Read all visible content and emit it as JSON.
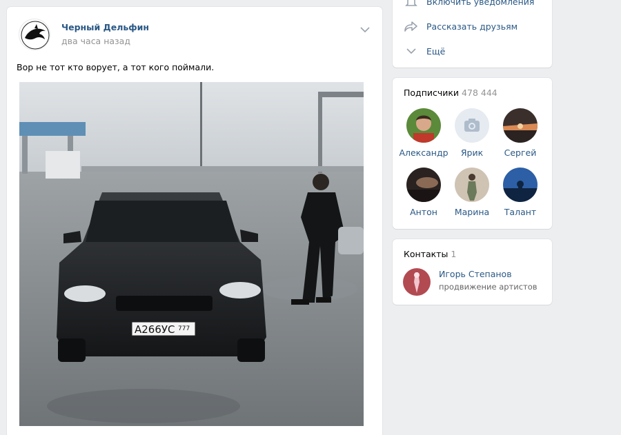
{
  "post": {
    "author": "Черный Дельфин",
    "time": "два часа назад",
    "text": "Вор не тот кто ворует, а тот кого поймали.",
    "menu_icon": "chevron-down-icon",
    "photo": {
      "subject": "car-photo",
      "plate_text": "А266УС",
      "plate_region": "777"
    }
  },
  "actions": {
    "items": [
      {
        "label": "Включить уведомления",
        "icon": "bell-icon"
      },
      {
        "label": "Рассказать друзьям",
        "icon": "share-icon"
      },
      {
        "label": "Ещё",
        "icon": "chevron-down-icon"
      }
    ]
  },
  "subscribers": {
    "title": "Подписчики",
    "count": "478 444",
    "people": [
      {
        "name": "Александр"
      },
      {
        "name": "Ярик"
      },
      {
        "name": "Сергей"
      },
      {
        "name": "Антон"
      },
      {
        "name": "Марина"
      },
      {
        "name": "Талант"
      }
    ]
  },
  "contacts": {
    "title": "Контакты",
    "count": "1",
    "person": {
      "name": "Игорь Степанов",
      "role": "продвижение артистов"
    }
  },
  "colors": {
    "link": "#2a5885",
    "muted": "#939393",
    "background": "#edeef0"
  }
}
